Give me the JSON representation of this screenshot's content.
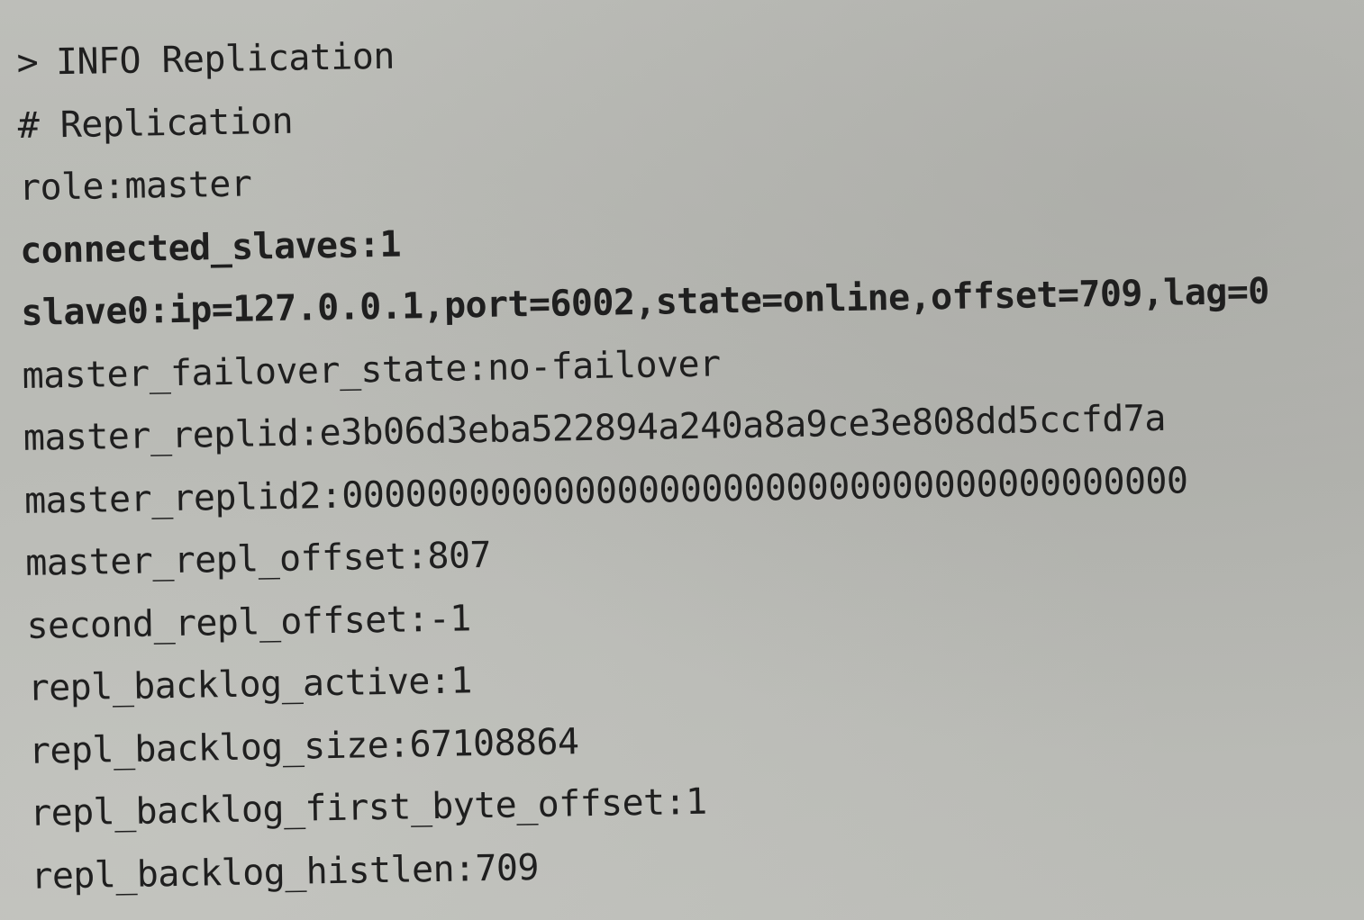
{
  "terminal": {
    "prompt_symbol": ">",
    "command": "INFO Replication",
    "lines": [
      "# Replication",
      "role:master",
      "connected_slaves:1",
      "slave0:ip=127.0.0.1,port=6002,state=online,offset=709,lag=0",
      "master_failover_state:no-failover",
      "master_replid:e3b06d3eba522894a240a8a9ce3e808dd5ccfd7a",
      "master_replid2:0000000000000000000000000000000000000000",
      "master_repl_offset:807",
      "second_repl_offset:-1",
      "repl_backlog_active:1",
      "repl_backlog_size:67108864",
      "repl_backlog_first_byte_offset:1",
      "repl_backlog_histlen:709"
    ]
  }
}
